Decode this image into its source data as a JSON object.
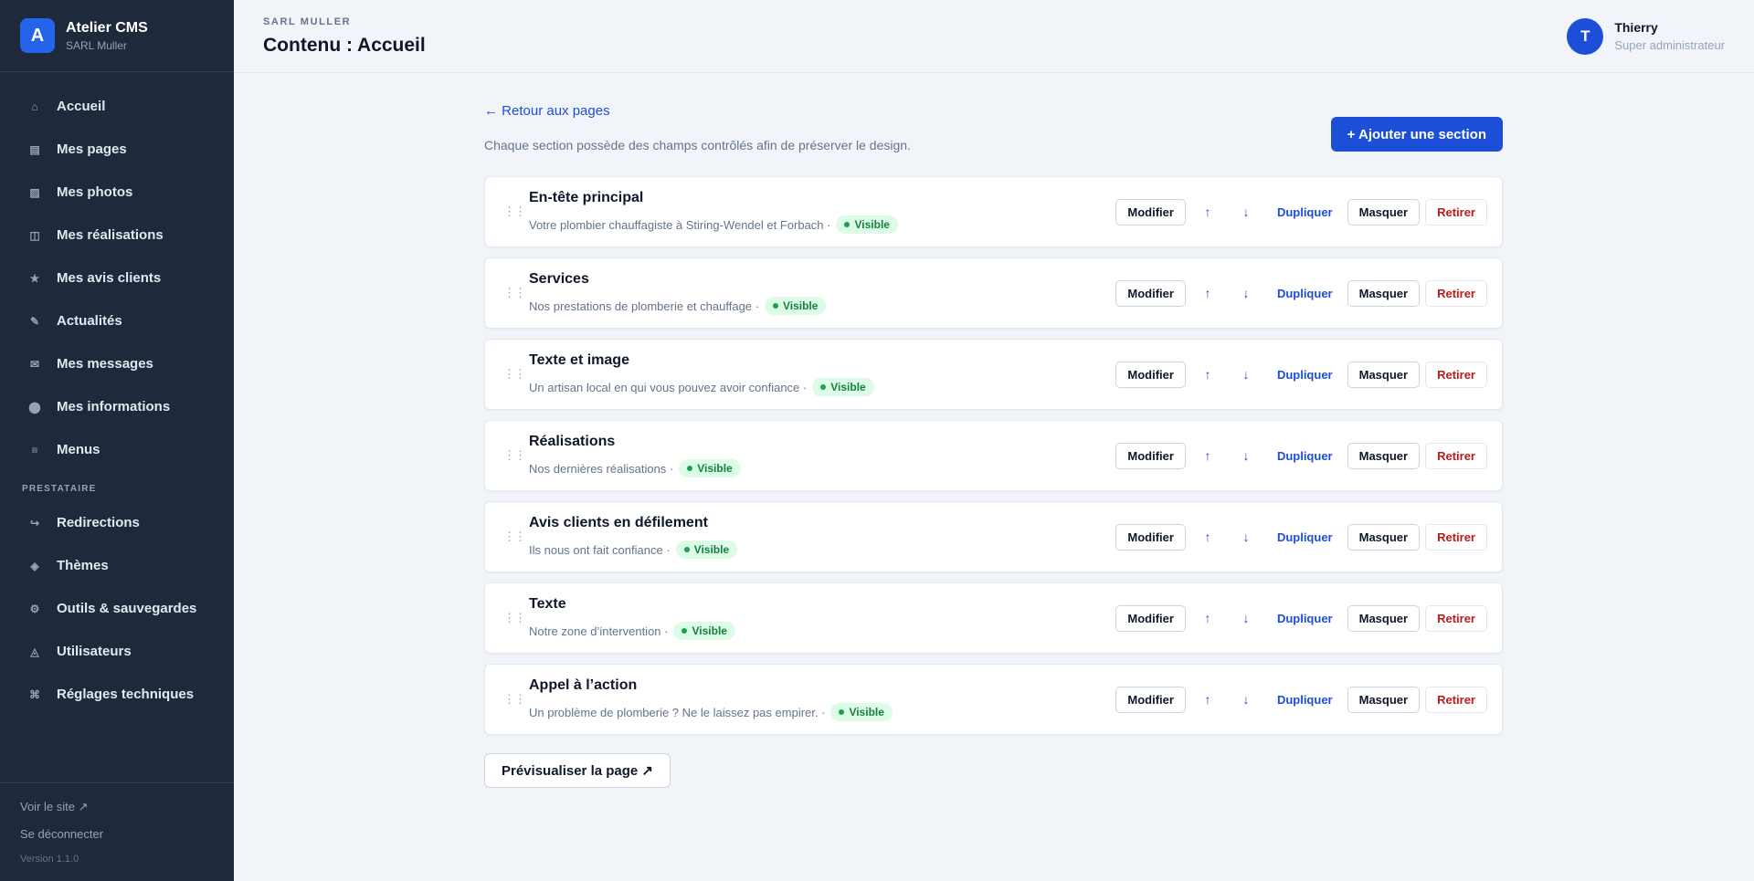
{
  "brand": {
    "logo_letter": "A",
    "name": "Atelier CMS",
    "subtitle": "SARL Muller"
  },
  "sidebar": {
    "items": [
      {
        "label": "Accueil",
        "icon": "home-icon",
        "glyph": "⌂"
      },
      {
        "label": "Mes pages",
        "icon": "pages-icon",
        "glyph": "▤"
      },
      {
        "label": "Mes photos",
        "icon": "photos-icon",
        "glyph": "▨"
      },
      {
        "label": "Mes réalisations",
        "icon": "portfolio-icon",
        "glyph": "◫"
      },
      {
        "label": "Mes avis clients",
        "icon": "star-icon",
        "glyph": "★"
      },
      {
        "label": "Actualités",
        "icon": "pencil-icon",
        "glyph": "✎"
      },
      {
        "label": "Mes messages",
        "icon": "mail-icon",
        "glyph": "✉"
      },
      {
        "label": "Mes informations",
        "icon": "info-icon",
        "glyph": "⬤"
      },
      {
        "label": "Menus",
        "icon": "menu-icon",
        "glyph": "≡"
      }
    ],
    "section_label": "PRESTATAIRE",
    "provider_items": [
      {
        "label": "Redirections",
        "icon": "redirect-icon",
        "glyph": "↪"
      },
      {
        "label": "Thèmes",
        "icon": "theme-icon",
        "glyph": "◈"
      },
      {
        "label": "Outils & sauvegardes",
        "icon": "tools-icon",
        "glyph": "⚙"
      },
      {
        "label": "Utilisateurs",
        "icon": "users-icon",
        "glyph": "◬"
      },
      {
        "label": "Réglages techniques",
        "icon": "settings-icon",
        "glyph": "⌘"
      }
    ],
    "footer": {
      "view_site": "Voir le site ↗",
      "logout": "Se déconnecter",
      "version": "Version 1.1.0"
    }
  },
  "header": {
    "breadcrumb": "SARL MULLER",
    "title": "Contenu : Accueil"
  },
  "user": {
    "initial": "T",
    "name": "Thierry",
    "role": "Super administrateur"
  },
  "main": {
    "back_link": "← Retour aux pages",
    "description": "Chaque section possède des champs contrôlés afin de préserver le design.",
    "add_button": "+ Ajouter une section",
    "preview_button": "Prévisualiser la page ↗",
    "action_labels": {
      "edit": "Modifier",
      "up": "↑",
      "down": "↓",
      "duplicate": "Dupliquer",
      "hide": "Masquer",
      "remove": "Retirer"
    },
    "sections": [
      {
        "title": "En-tête principal",
        "subtitle": "Votre plombier chauffagiste à Stiring-Wendel et Forbach ·",
        "status": "Visible"
      },
      {
        "title": "Services",
        "subtitle": "Nos prestations de plomberie et chauffage ·",
        "status": "Visible"
      },
      {
        "title": "Texte et image",
        "subtitle": "Un artisan local en qui vous pouvez avoir confiance ·",
        "status": "Visible"
      },
      {
        "title": "Réalisations",
        "subtitle": "Nos dernières réalisations ·",
        "status": "Visible"
      },
      {
        "title": "Avis clients en défilement",
        "subtitle": "Ils nous ont fait confiance ·",
        "status": "Visible"
      },
      {
        "title": "Texte",
        "subtitle": "Notre zone d’intervention ·",
        "status": "Visible"
      },
      {
        "title": "Appel à l’action",
        "subtitle": "Un problème de plomberie ? Ne le laissez pas empirer. ·",
        "status": "Visible"
      }
    ]
  },
  "colors": {
    "sidebar_bg": "#1e293b",
    "accent": "#1d4ed8",
    "success": "#15803d",
    "danger": "#b91c1c"
  }
}
